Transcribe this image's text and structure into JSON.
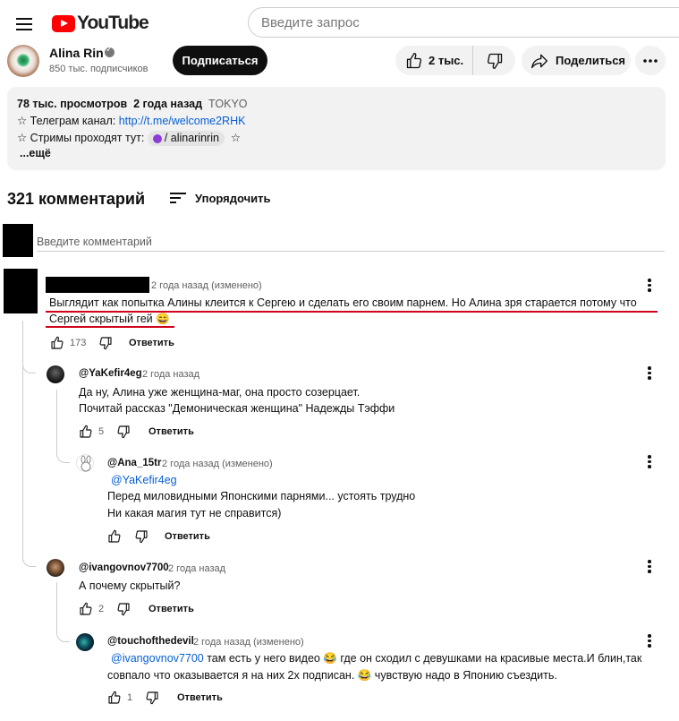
{
  "header": {
    "logo_text": "YouTube",
    "search_placeholder": "Введите запрос"
  },
  "channel": {
    "name": "Alina Rin",
    "subscribers": "850 тыс. подписчиков",
    "subscribe_label": "Подписаться",
    "likes": "2 тыс.",
    "share_label": "Поделиться"
  },
  "description": {
    "views": "78 тыс. просмотров",
    "date": "2 года назад",
    "tag": "TOKYO",
    "line1_prefix": "☆ Телеграм канал: ",
    "line1_link": "http://t.me/welcome2RHK",
    "line2_prefix": "☆ Стримы проходят тут: ",
    "line2_chip": "/ alinarinrin",
    "line2_suffix": "☆",
    "more": "...ещё"
  },
  "comments_header": {
    "count": "321 комментарий",
    "sort_label": "Упорядочить",
    "input_placeholder": "Введите комментарий"
  },
  "comments": [
    {
      "meta": "2 года назад (изменено)",
      "line1": "Выглядит как попытка Алины клеится к Сергею и сделать его своим парнем. Но Алина зря старается потому что",
      "line2": "Сергей скрытый гей 😄",
      "likes": "173",
      "reply": "Ответить"
    },
    {
      "author": "@YaKefir4eg",
      "meta": "2 года назад",
      "line1": "Да ну, Алина уже женщина-маг, она просто созерцает.",
      "line2": "Почитай рассказ \"Демоническая женщина\" Надежды Тэффи",
      "likes": "5",
      "reply": "Ответить"
    },
    {
      "author": "@Ana_15tr",
      "meta": "2 года назад (изменено)",
      "mention": "@YaKefir4eg",
      "line1": "Перед миловидными Японскими парнями... устоять трудно",
      "line2": "Ни какая магия тут не справится)",
      "reply": "Ответить"
    },
    {
      "author": "@ivangovnov7700",
      "meta": "2 года назад",
      "line1": "А почему скрытый?",
      "likes": "2",
      "reply": "Ответить"
    },
    {
      "author": "@touchofthedevil",
      "meta": "2 года назад (изменено)",
      "mention": "@ivangovnov7700",
      "line1_rest": " там есть у него видео 😂 где он сходил с девушками на красивые места.И блин,так",
      "line2": "совпало что оказывается я на них 2х подписан. 😂 чувствую надо в Японию съездить.",
      "likes": "1",
      "reply": "Ответить"
    }
  ],
  "colors": {
    "accent_red": "#ff0000",
    "link_blue": "#065fd4",
    "annotation_red": "#d0021b"
  },
  "icons": [
    "menu-icon",
    "youtube-logo-icon",
    "verified-icon",
    "thumbs-up-icon",
    "thumbs-down-icon",
    "share-icon",
    "more-icon",
    "sort-icon",
    "kebab-icon"
  ]
}
